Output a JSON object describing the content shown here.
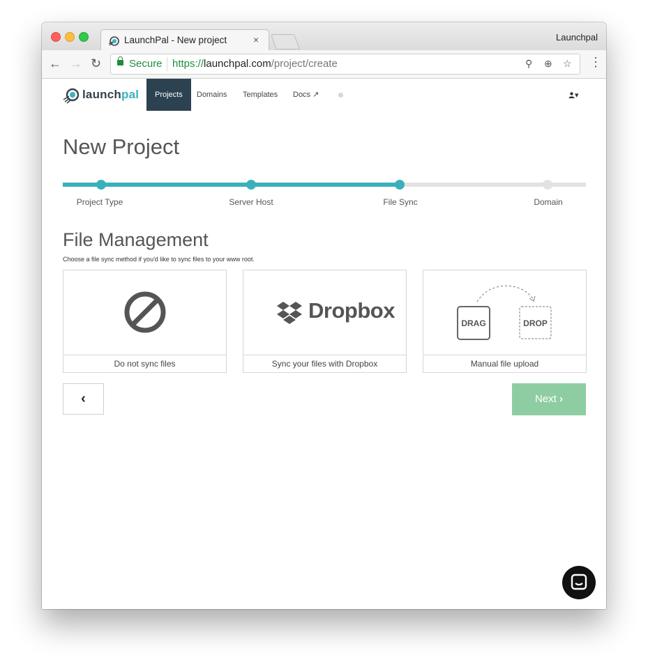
{
  "browser": {
    "tab_title": "LaunchPal - New project",
    "tab_close": "×",
    "profile_name": "Launchpal",
    "secure_label": "Secure",
    "url_scheme": "https://",
    "url_domain": "launchpal.com",
    "url_path": "/project/create",
    "back_glyph": "←",
    "forward_glyph": "→",
    "reload_glyph": "↻",
    "extension_glyph": "⚲",
    "zoom_glyph": "⊕",
    "star_glyph": "☆",
    "menu_glyph": "⋮"
  },
  "nav": {
    "logo_launch": "launch",
    "logo_pal": "pal",
    "items": [
      {
        "label": "Projects",
        "active": true
      },
      {
        "label": "Domains"
      },
      {
        "label": "Templates"
      },
      {
        "label": "Docs"
      }
    ],
    "docs_external_glyph": "↗",
    "user_glyph": "▾"
  },
  "page": {
    "title": "New Project",
    "steps": [
      {
        "label": "Project Type",
        "done": true
      },
      {
        "label": "Server Host",
        "done": true
      },
      {
        "label": "File Sync",
        "done": true
      },
      {
        "label": "Domain",
        "done": false
      }
    ],
    "progress": 0.645,
    "section_title": "File Management",
    "section_desc": "Choose a file sync method if you'd like to sync files to your www root.",
    "options": [
      {
        "label": "Do not sync files",
        "icon": "no-sync-icon"
      },
      {
        "label": "Sync your files with Dropbox",
        "icon": "dropbox-logo",
        "brand_text": "Dropbox"
      },
      {
        "label": "Manual file upload",
        "icon": "drag-drop-icon",
        "drag_text": "DRAG",
        "drop_text": "DROP"
      }
    ],
    "back_glyph": "‹",
    "next_label": "Next",
    "next_glyph": "›"
  },
  "colors": {
    "accent": "#3ab0bc",
    "nav_active": "#2c4250",
    "next_button": "#8ecda2",
    "secure_green": "#1e8e3e"
  }
}
